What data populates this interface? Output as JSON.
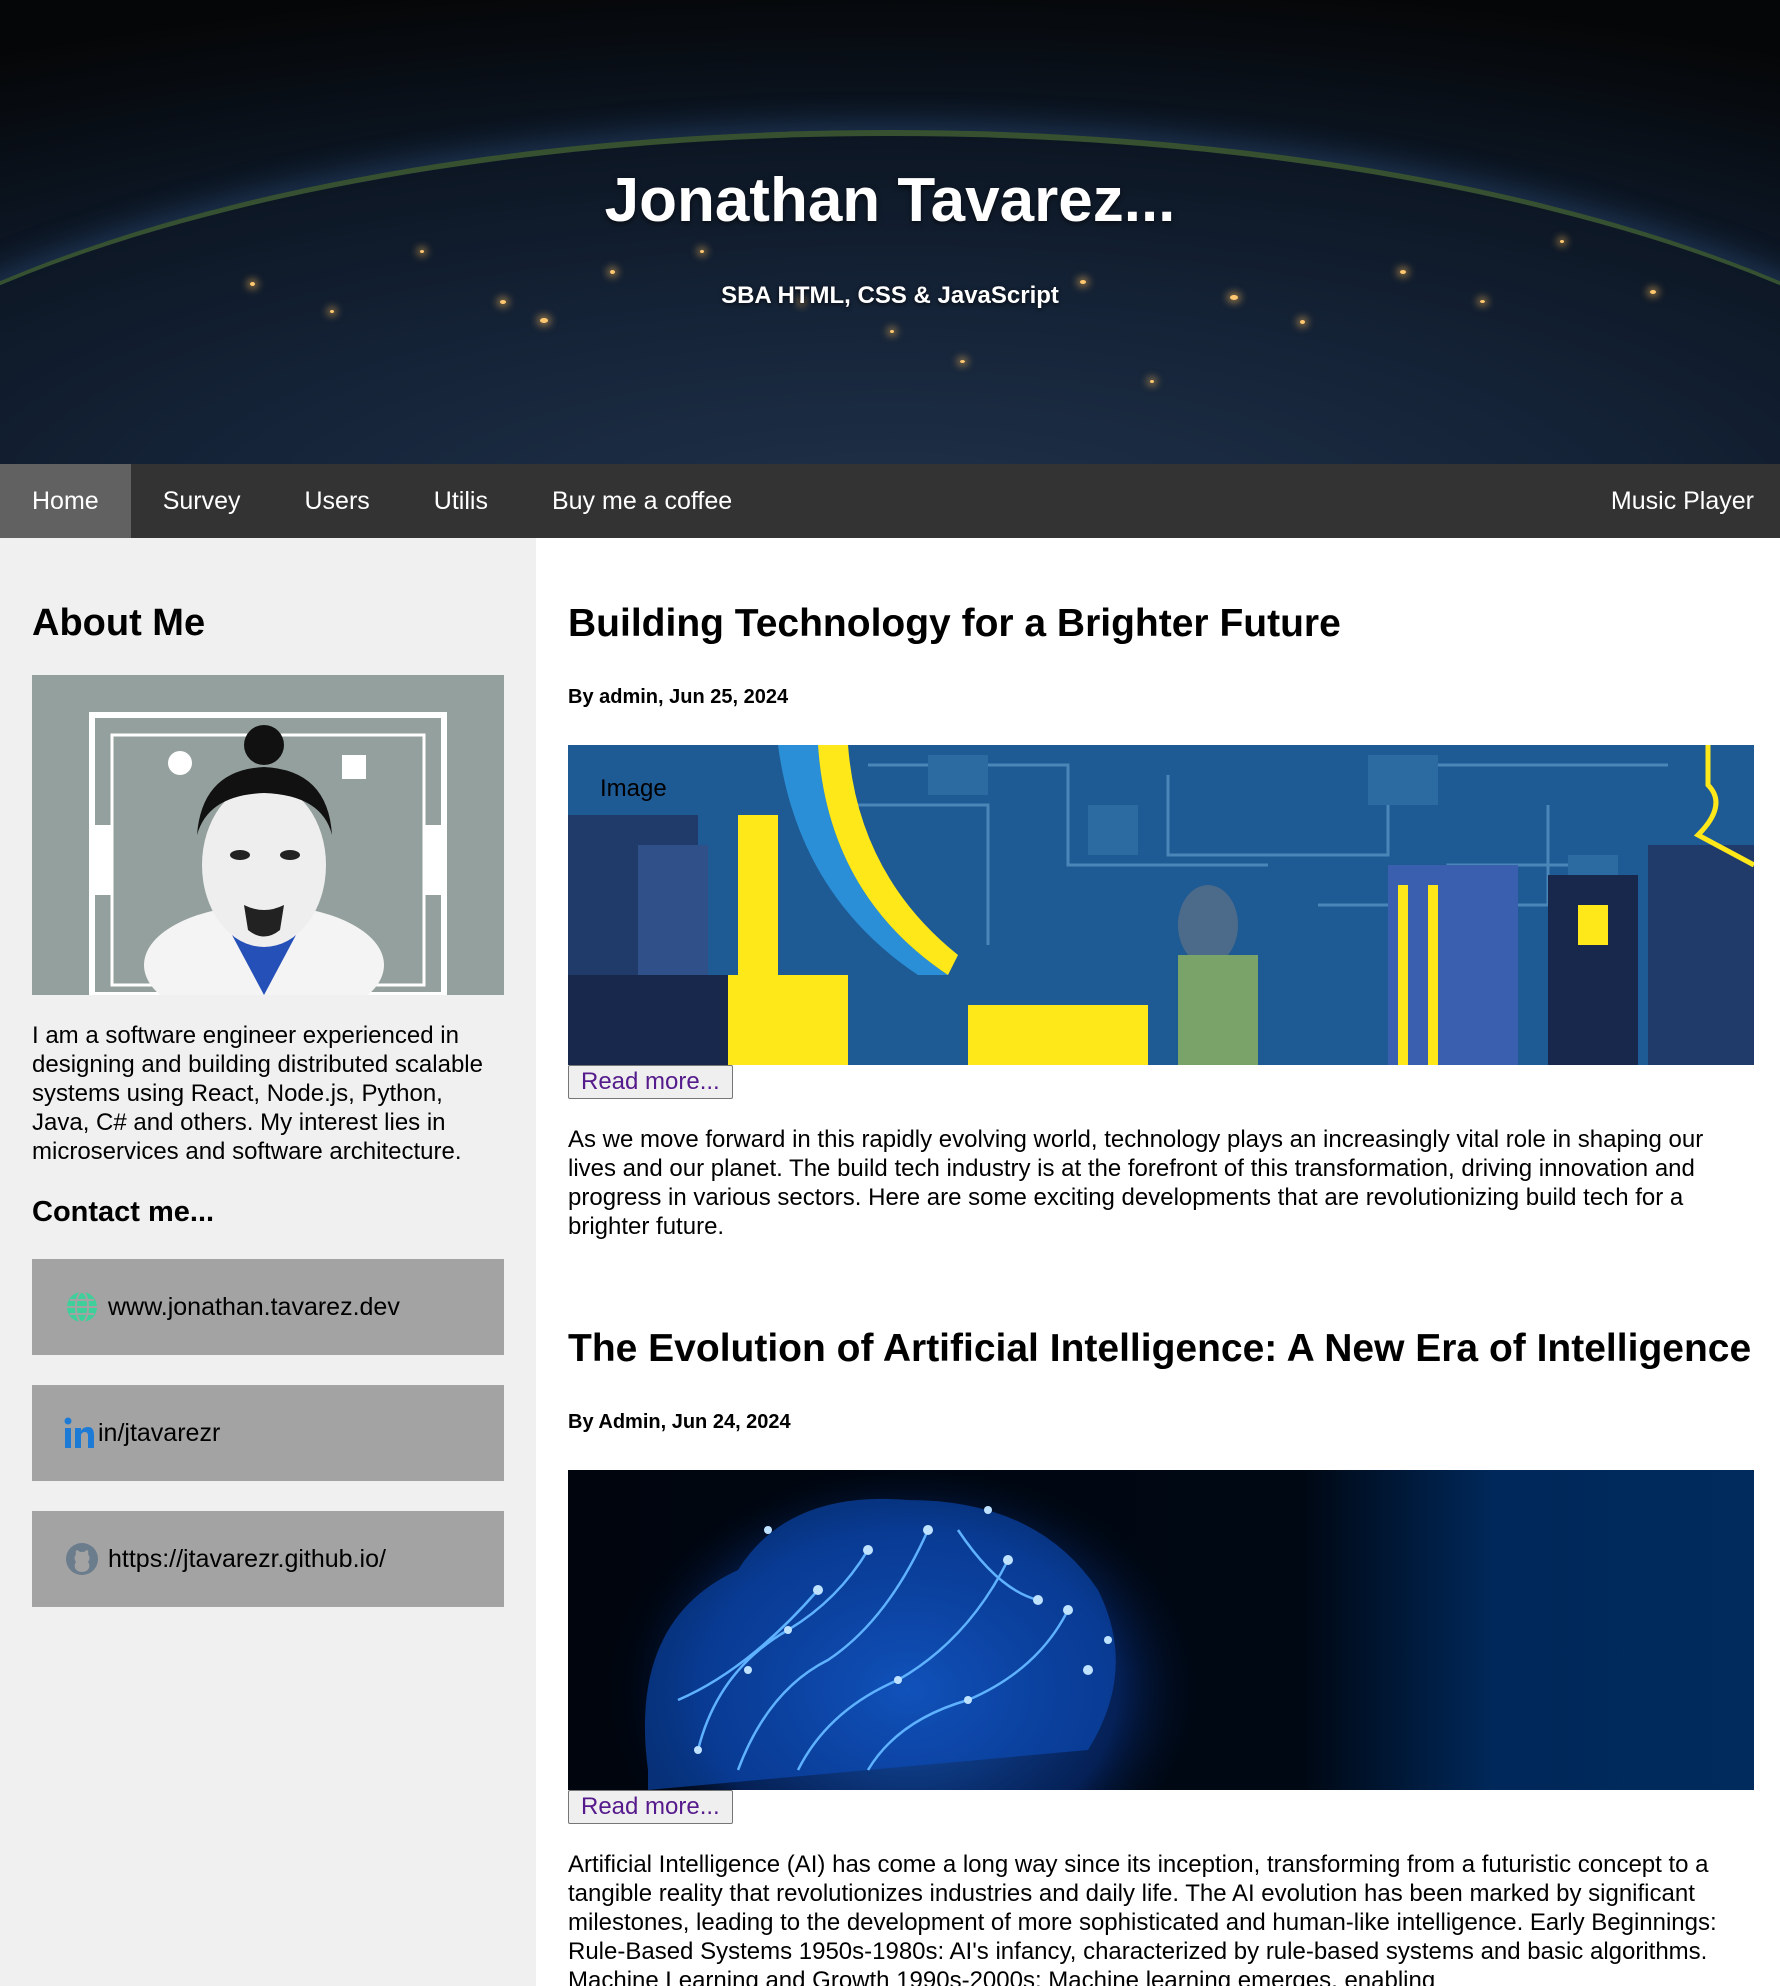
{
  "header": {
    "title": "Jonathan Tavarez...",
    "subtitle": "SBA HTML, CSS & JavaScript"
  },
  "nav": {
    "items": [
      {
        "label": "Home"
      },
      {
        "label": "Survey"
      },
      {
        "label": "Users"
      },
      {
        "label": "Utilis"
      },
      {
        "label": "Buy me a coffee"
      }
    ],
    "right_label": "Music Player"
  },
  "sidebar": {
    "about_title": "About Me",
    "about_text": "I am a software engineer experienced in designing and building distributed scalable systems using React, Node.js, Python, Java, C# and others. My interest lies in microservices and software architecture.",
    "contact_title": "Contact me...",
    "contacts": [
      {
        "label": "www.jonathan.tavarez.dev",
        "icon": "globe-icon"
      },
      {
        "label": "in/jtavarezr",
        "icon": "linkedin-icon"
      },
      {
        "label": "https://jtavarezr.github.io/",
        "icon": "github-icon"
      }
    ]
  },
  "posts": [
    {
      "title": "Building Technology for a Brighter Future",
      "meta": "By admin, Jun 25, 2024",
      "image_alt": "Image",
      "read_more": "Read more...",
      "body": "As we move forward in this rapidly evolving world, technology plays an increasingly vital role in shaping our lives and our planet. The build tech industry is at the forefront of this transformation, driving innovation and progress in various sectors. Here are some exciting developments that are revolutionizing build tech for a brighter future."
    },
    {
      "title": "The Evolution of Artificial Intelligence: A New Era of Intelligence",
      "meta": "By Admin, Jun 24, 2024",
      "read_more": "Read more...",
      "body": "Artificial Intelligence (AI) has come a long way since its inception, transforming from a futuristic concept to a tangible reality that revolutionizes industries and daily life. The AI evolution has been marked by significant milestones, leading to the development of more sophisticated and human-like intelligence. Early Beginnings: Rule-Based Systems 1950s-1980s: AI's infancy, characterized by rule-based systems and basic algorithms. Machine Learning and Growth 1990s-2000s: Machine learning emerges, enabling"
    }
  ],
  "colors": {
    "nav_bg": "#333333",
    "nav_active": "#616161",
    "contact_bg": "#a3a3a3",
    "link": "#551a8b"
  }
}
